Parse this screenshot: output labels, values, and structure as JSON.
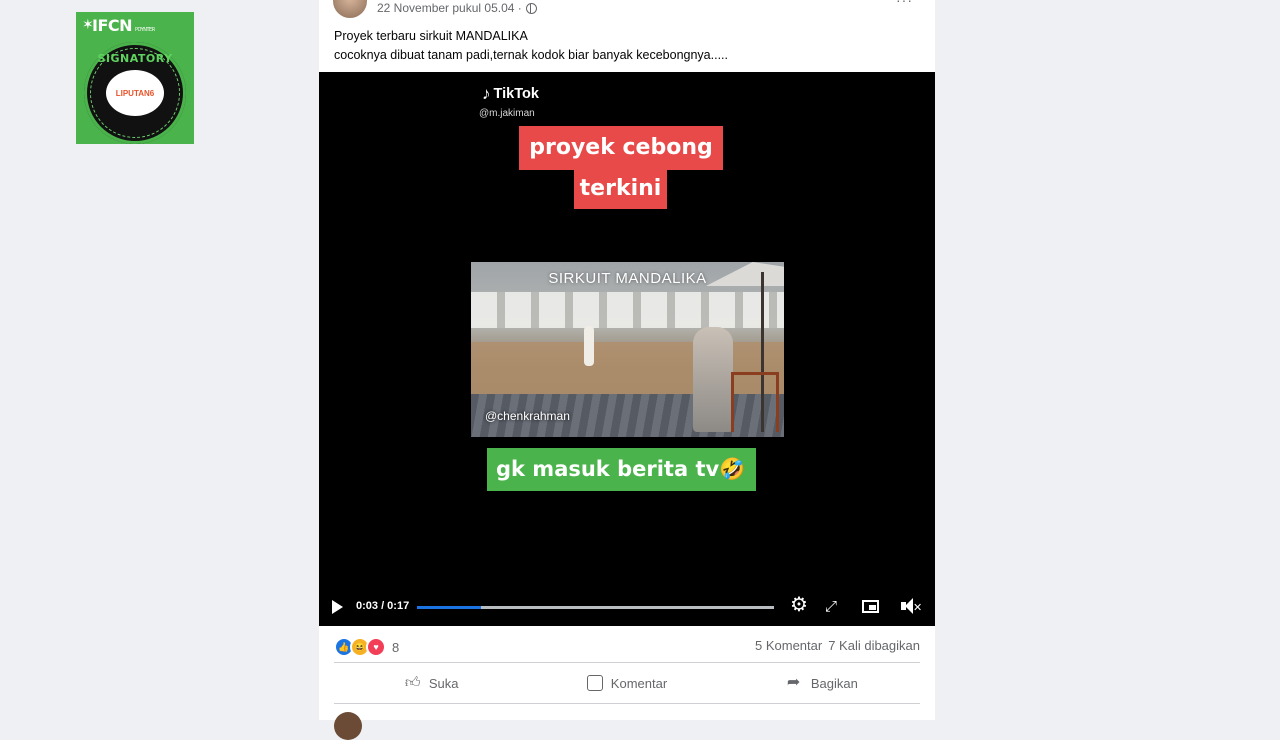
{
  "badge": {
    "org": "IFCN",
    "org_sub": "POYNTER",
    "seal_title": "SIGNATORY",
    "seal_core": "LIPUTAN6"
  },
  "post": {
    "timestamp": "22 November pukul 05.04 ·",
    "caption_line1": "Proyek terbaru sirkuit MANDALIKA",
    "caption_line2": "cocoknya dibuat tanam padi,ternak kodok biar banyak kecebongnya.....",
    "video": {
      "tiktok_label": "TikTok",
      "tiktok_handle": "@m.jakiman",
      "overlay_top_1": "proyek cebong",
      "overlay_top_2": "terkini",
      "scene_title": "SIRKUIT MANDALIKA",
      "scene_handle": "@chenkrahman",
      "overlay_bottom": "gk masuk berita tv🤣",
      "time": "0:03 / 0:17",
      "progress": 0.18
    },
    "reaction_count": "8",
    "comments": "5 Komentar",
    "shares": "7 Kali dibagikan",
    "actions": {
      "like": "Suka",
      "comment": "Komentar",
      "share": "Bagikan"
    }
  },
  "colors": {
    "accent": "#1b74e4",
    "badge_green": "#4bb34b",
    "overlay_red": "#e84a4a"
  }
}
